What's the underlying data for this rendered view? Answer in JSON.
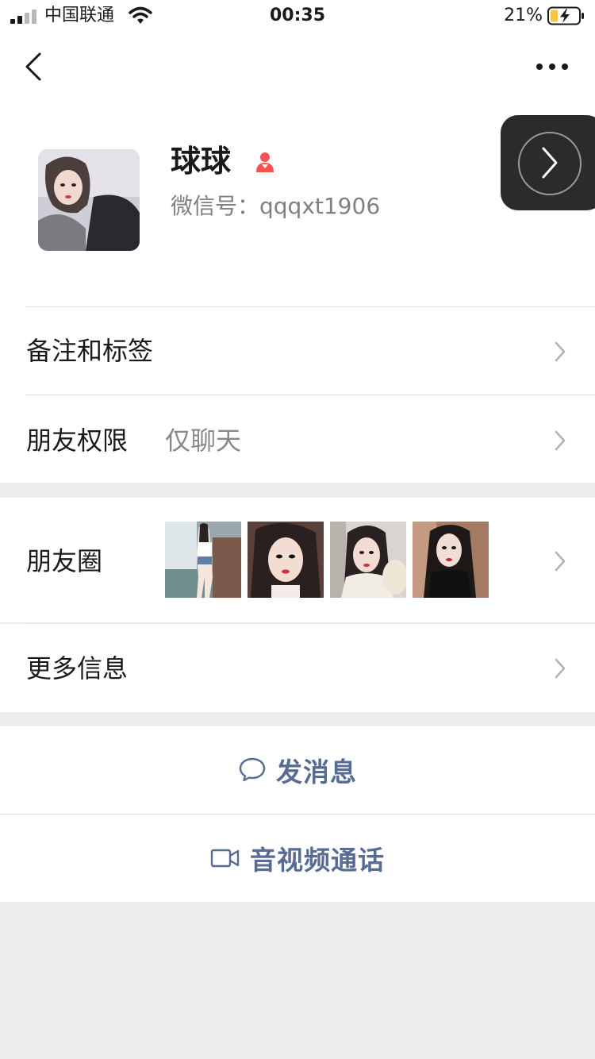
{
  "status_bar": {
    "carrier": "中国联通",
    "time": "00:35",
    "battery": "21%"
  },
  "profile": {
    "name": "球球",
    "wechat_id": "微信号：qqqxt1906",
    "gender_icon": "female-icon"
  },
  "menu": {
    "remark_label": "备注和标签",
    "privacy_label": "朋友权限",
    "privacy_value": "仅聊天",
    "moments_label": "朋友圈",
    "more_info_label": "更多信息"
  },
  "actions": {
    "message_label": "发消息",
    "video_label": "音视频通话"
  },
  "colors": {
    "link": "#576b95",
    "gender_female": "#fa5151",
    "battery_fill": "#f7c744"
  }
}
